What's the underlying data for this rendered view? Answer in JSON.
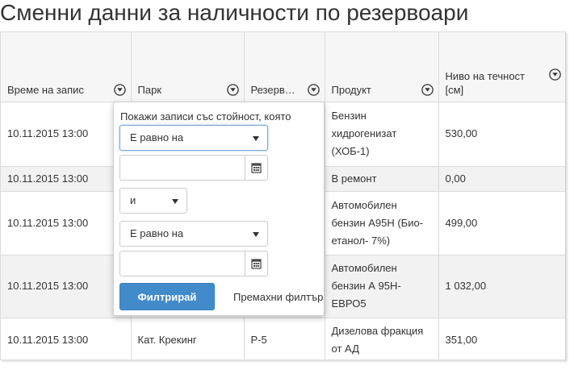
{
  "page": {
    "title": "Сменни данни за наличности по резервоари"
  },
  "grid": {
    "columns": [
      {
        "label": "Време на запис"
      },
      {
        "label": "Парк"
      },
      {
        "label": "Резервоар"
      },
      {
        "label": "Продукт"
      },
      {
        "label": "Ниво на течност [см]"
      }
    ],
    "rows": [
      {
        "time": "10.11.2015 13:00",
        "park": "",
        "tank": "",
        "product": "Бензин хидрогенизат (ХОБ-1)",
        "level": "530,00"
      },
      {
        "time": "10.11.2015 13:00",
        "park": "",
        "tank": "",
        "product": "В ремонт",
        "level": "0,00"
      },
      {
        "time": "10.11.2015 13:00",
        "park": "",
        "tank": "",
        "product": "Автомобилен бензин А95Н (Био-етанол- 7%)",
        "level": "499,00"
      },
      {
        "time": "10.11.2015 13:00",
        "park": "",
        "tank": "",
        "product": "Автомобилен бензин А 95Н-ЕВРО5",
        "level": "1 032,00"
      },
      {
        "time": "10.11.2015 13:00",
        "park": "Кат. Крекинг",
        "tank": "Р-5",
        "product": "Дизелова фракция от АД",
        "level": "351,00"
      }
    ]
  },
  "filter_popup": {
    "label": "Покажи записи със стойност, която",
    "operator1": "Е равно на",
    "value1": "",
    "logic": "и",
    "operator2": "Е равно на",
    "value2": "",
    "apply_label": "Филтрирай",
    "clear_label": "Премахни филтър"
  },
  "icons": {
    "filter": "filter-icon",
    "calendar": "calendar-icon",
    "dropdown": "caret-down-icon"
  },
  "colors": {
    "primary": "#428bca",
    "alt_row": "#f2f2f2",
    "header_bg": "#f6f6f6",
    "border": "#dcdcdc"
  }
}
